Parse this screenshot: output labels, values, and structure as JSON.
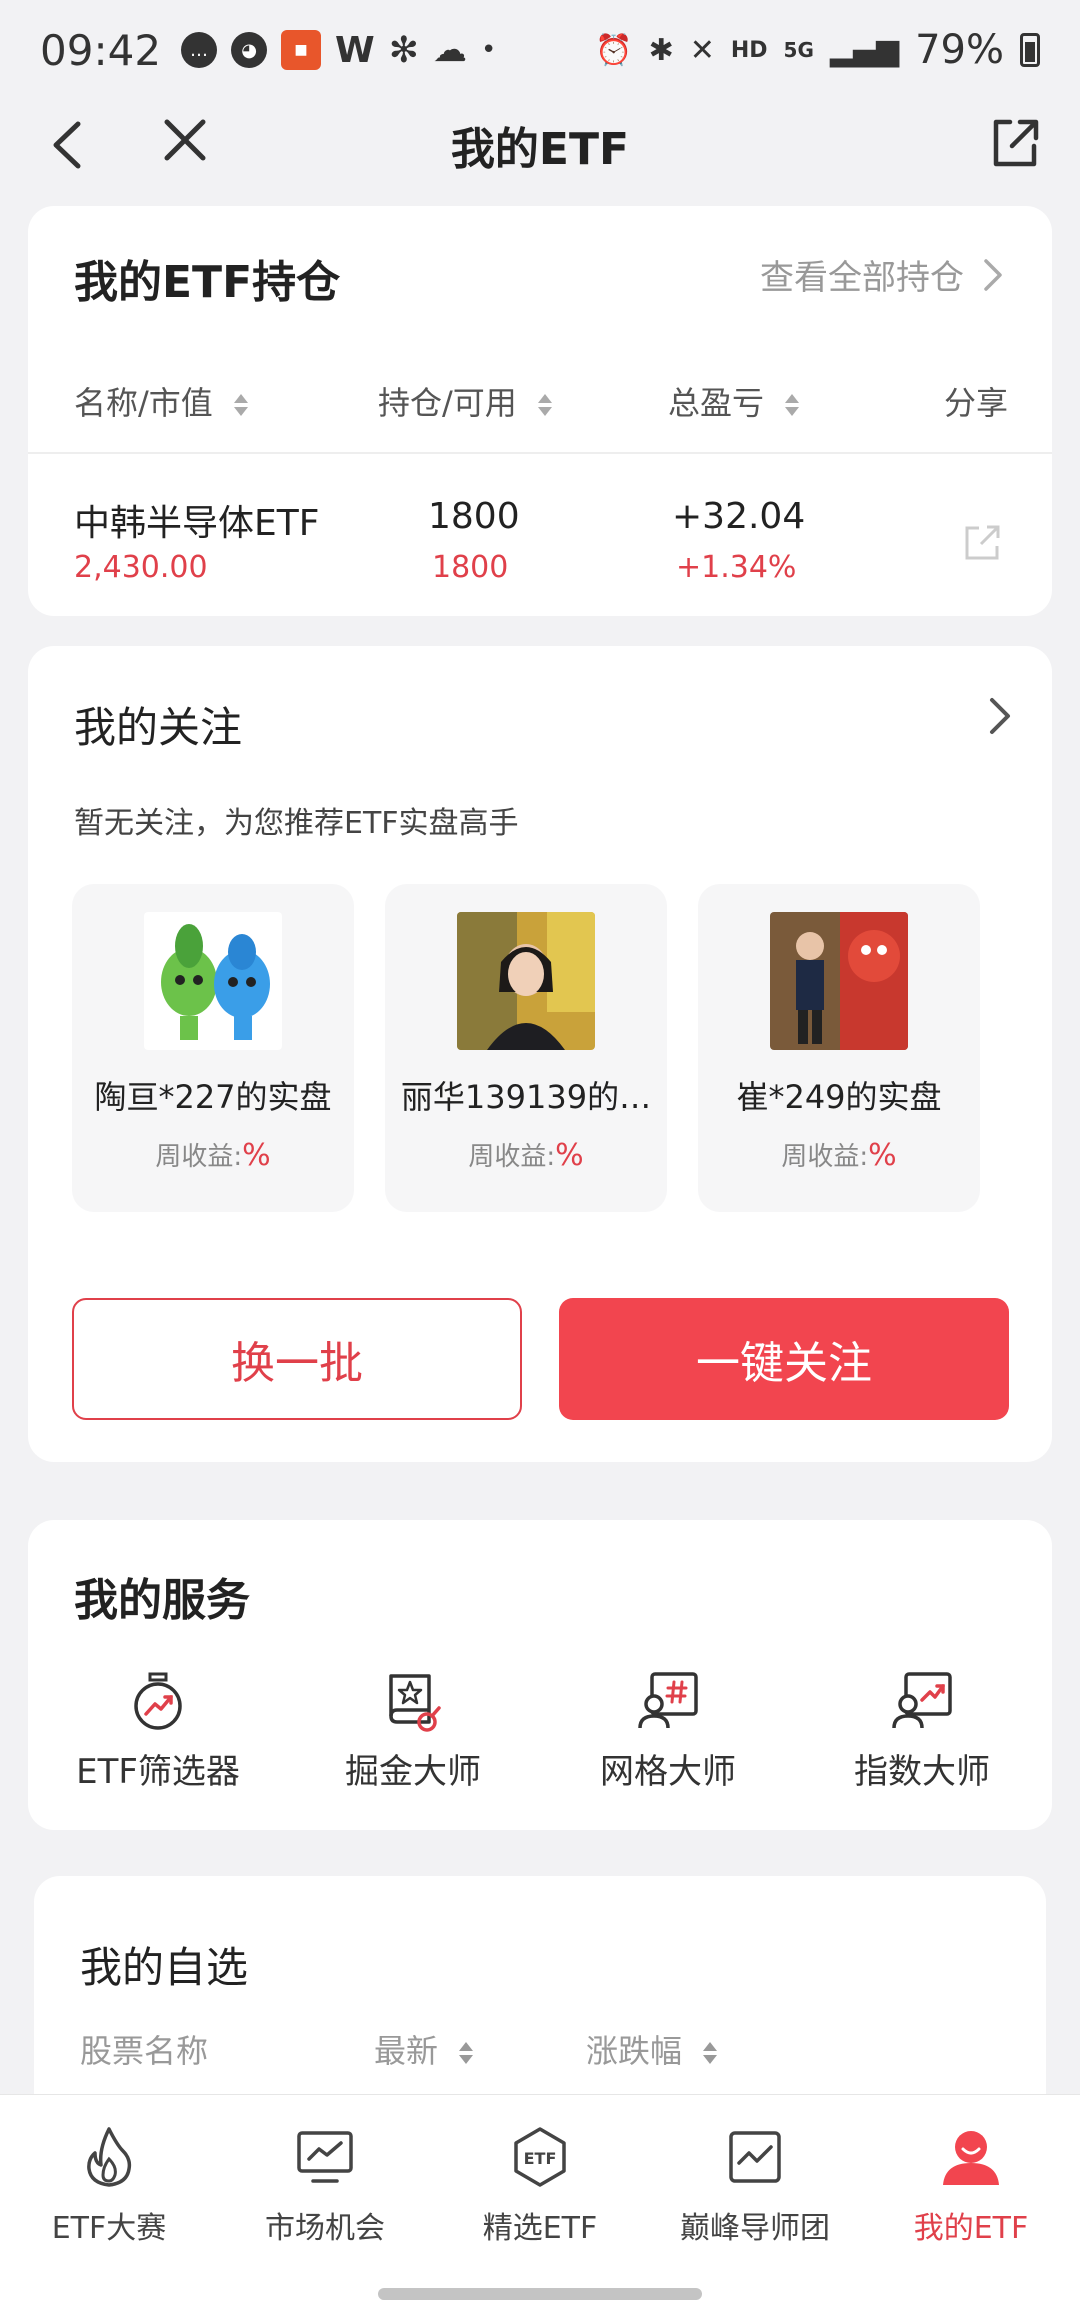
{
  "status_bar": {
    "time": "09:42",
    "battery": "79%",
    "hd": "HD",
    "net": "5G"
  },
  "nav": {
    "title": "我的ETF"
  },
  "holdings": {
    "title": "我的ETF持仓",
    "view_all": "查看全部持仓",
    "headers": [
      "名称/市值",
      "持仓/可用",
      "总盈亏",
      "分享"
    ],
    "rows": [
      {
        "name": "中韩半导体ETF",
        "value": "2,430.00",
        "position": "1800",
        "available": "1800",
        "pnl": "+32.04",
        "pnl_pct": "+1.34%"
      }
    ]
  },
  "follow": {
    "title": "我的关注",
    "subtitle": "暂无关注，为您推荐ETF实盘高手",
    "experts": [
      {
        "name": "陶亘*227的实盘",
        "weekly_label": "周收益:",
        "weekly_value": "%"
      },
      {
        "name": "丽华139139的…",
        "weekly_label": "周收益:",
        "weekly_value": "%"
      },
      {
        "name": "崔*249的实盘",
        "weekly_label": "周收益:",
        "weekly_value": "%"
      }
    ],
    "refresh_label": "换一批",
    "follow_all_label": "一键关注"
  },
  "services": {
    "title": "我的服务",
    "items": [
      {
        "label": "ETF筛选器",
        "icon": "stopwatch-chart-icon"
      },
      {
        "label": "掘金大师",
        "icon": "book-star-icon"
      },
      {
        "label": "网格大师",
        "icon": "user-grid-icon"
      },
      {
        "label": "指数大师",
        "icon": "user-chart-icon"
      }
    ]
  },
  "watchlist": {
    "title": "我的自选",
    "headers": [
      "股票名称",
      "最新",
      "涨跌幅"
    ]
  },
  "bottom_nav": {
    "items": [
      {
        "label": "ETF大赛",
        "icon": "flame-icon",
        "active": false
      },
      {
        "label": "市场机会",
        "icon": "monitor-chart-icon",
        "active": false
      },
      {
        "label": "精选ETF",
        "icon": "etf-badge-icon",
        "active": false
      },
      {
        "label": "巅峰导师团",
        "icon": "chart-frame-icon",
        "active": false
      },
      {
        "label": "我的ETF",
        "icon": "user-avatar-icon",
        "active": true
      }
    ]
  },
  "colors": {
    "accent": "#f2454f",
    "red_text": "#e0404a",
    "muted": "#888888"
  }
}
